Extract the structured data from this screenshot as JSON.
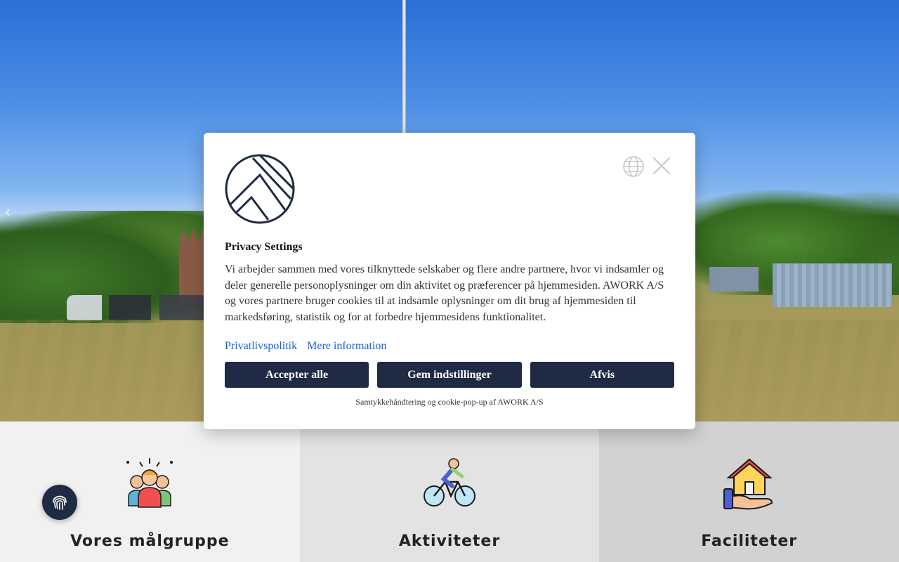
{
  "hero": {
    "prev_arrow": "‹"
  },
  "modal": {
    "title": "Privacy Settings",
    "body": "Vi arbejder sammen med vores tilknyttede selskaber og flere andre partnere, hvor vi indsamler og deler generelle personoplysninger om din aktivitet og præferencer på hjemmesiden. AWORK A/S og vores partnere bruger cookies til at indsamle oplysninger om dit brug af hjemmesiden til markedsføring, statistik og for at forbedre hjemmesidens funktionalitet.",
    "links": {
      "privacy": "Privatlivspolitik",
      "more": "Mere information"
    },
    "buttons": {
      "accept": "Accepter alle",
      "save": "Gem indstillinger",
      "reject": "Afvis"
    },
    "credit": "Samtykkehåndtering og cookie-pop-up af AWORK A/S",
    "icons": {
      "logo": "awork-logo",
      "language": "globe-icon",
      "close": "close-icon"
    }
  },
  "features": [
    {
      "title": "Vores målgruppe",
      "icon": "people-group-icon"
    },
    {
      "title": "Aktiviteter",
      "icon": "cyclist-icon"
    },
    {
      "title": "Faciliteter",
      "icon": "house-in-hand-icon"
    }
  ],
  "floating": {
    "icon": "fingerprint-icon"
  },
  "colors": {
    "navy": "#1f2a44",
    "link": "#1a5fd6"
  }
}
